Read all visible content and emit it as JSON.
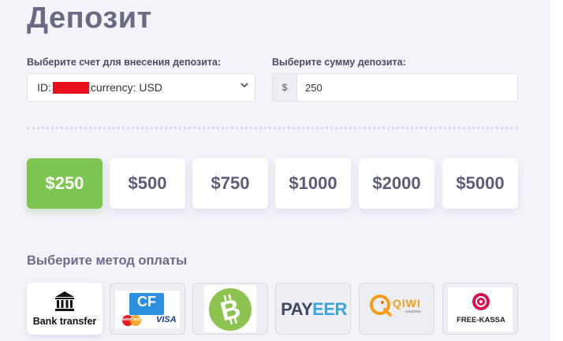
{
  "page": {
    "title": "Депозит"
  },
  "account": {
    "label": "Выберите счет для внесения депозита:",
    "id_prefix": "ID:",
    "currency_text": "currency: USD"
  },
  "amount": {
    "label": "Выберите сумму депозита:",
    "prefix": "$",
    "value": "250"
  },
  "amount_options": [
    {
      "label": "$250",
      "active": true
    },
    {
      "label": "$500"
    },
    {
      "label": "$750"
    },
    {
      "label": "$1000"
    },
    {
      "label": "$2000"
    },
    {
      "label": "$5000"
    }
  ],
  "payment": {
    "label": "Выберите метод оплаты",
    "methods": [
      {
        "name": "Bank transfer",
        "icon": "bank-icon"
      },
      {
        "name": "CF",
        "card_text": "MasterCard",
        "visa_text": "VISA",
        "icon": "cf-card-icon"
      },
      {
        "name": "bitcoin-cash",
        "icon": "bitcoin-icon"
      },
      {
        "name": "PAYEER",
        "icon": "payeer-icon"
      },
      {
        "name": "QIWI",
        "sub": "кошелек",
        "icon": "qiwi-icon"
      },
      {
        "name": "FREE-KASSA",
        "icon": "free-kassa-icon"
      }
    ]
  },
  "colors": {
    "active_green": "#7cc551",
    "background": "#f3f3fa",
    "text": "#5e5e7a",
    "redaction": "#e8111b"
  }
}
